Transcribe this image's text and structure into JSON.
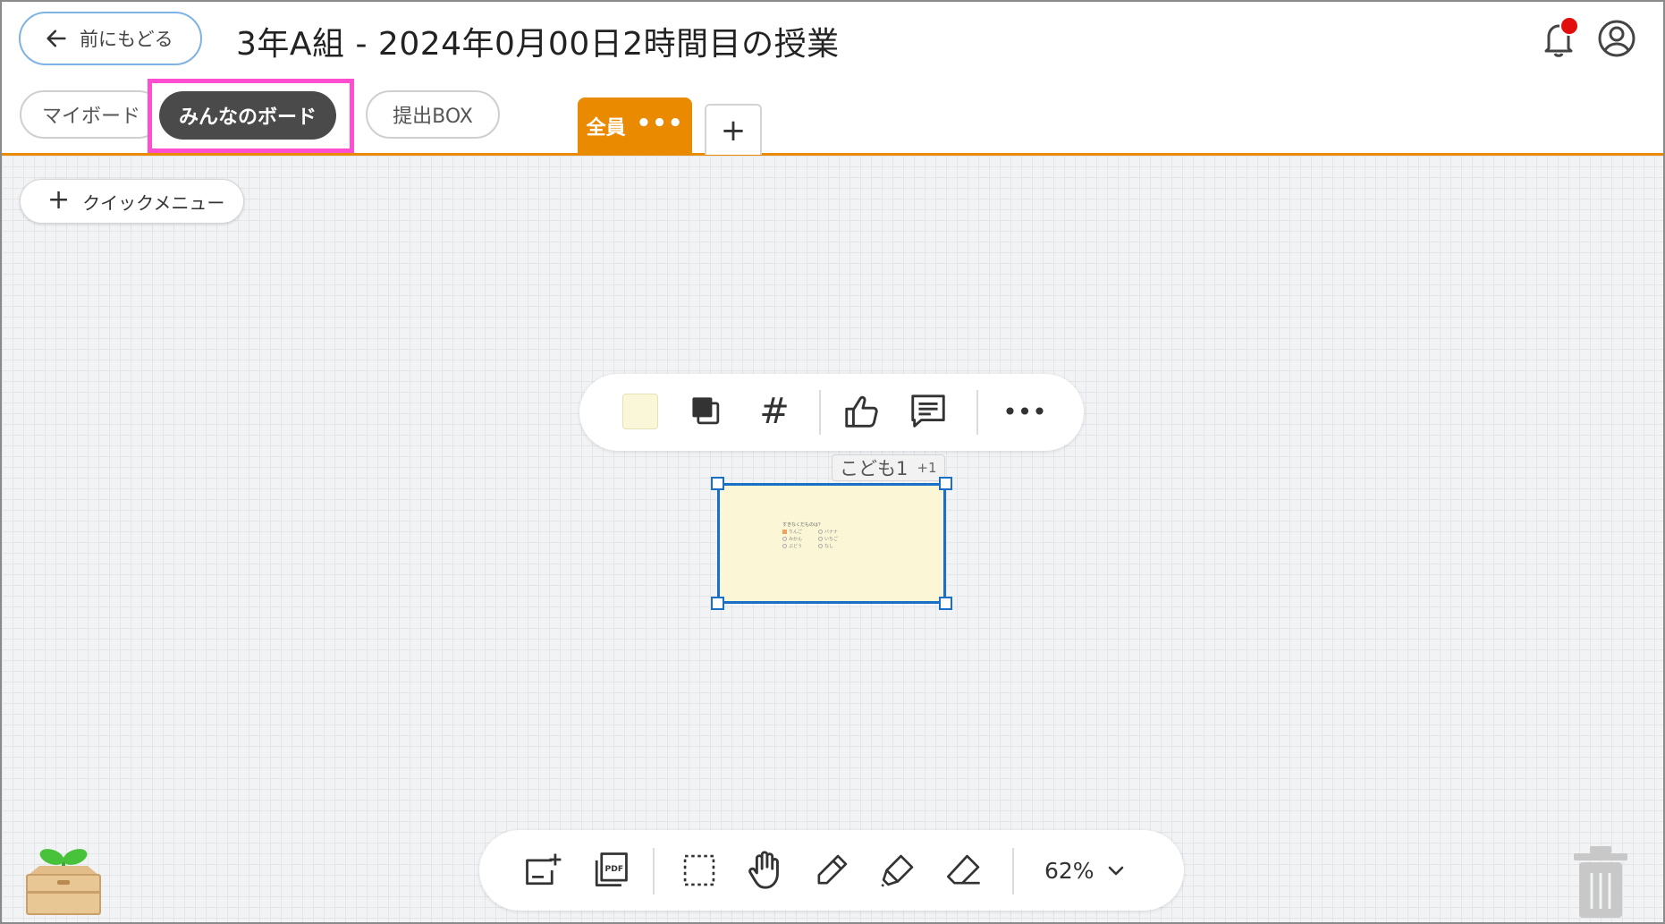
{
  "header": {
    "back_label": "前にもどる",
    "title": "3年A組 - 2024年0月00日2時間目の授業",
    "notification_color": "#e20e0e"
  },
  "tabs": {
    "my_board": "マイボード",
    "everyone_board": "みんなのボード",
    "submit_box": "提出BOX",
    "highlight_color": "#ff4fd0"
  },
  "group_tabs": {
    "active_label": "全員",
    "active_more": "•••",
    "add_label": "+",
    "accent_color": "#ea8a00"
  },
  "canvas": {
    "quick_menu_plus": "+",
    "quick_menu_label": "クイックメニュー"
  },
  "card_toolbar": {
    "icons": [
      "color-swatch-icon",
      "layer-order-icon",
      "hashtag-icon",
      "thumbs-up-icon",
      "comment-icon",
      "more-icon"
    ],
    "hashtag": "#",
    "more": "•••"
  },
  "card": {
    "owner": "こども1",
    "owner_extra": "+1",
    "preview_question": "すきなくだものは？",
    "preview_options_left": [
      "りんご",
      "みかん",
      "ぶどう"
    ],
    "preview_options_right": [
      "バナナ",
      "いちご",
      "なし"
    ],
    "fill_color": "#faf6d6",
    "selection_color": "#1a6fc6"
  },
  "bottom_toolbar": {
    "icons": [
      "add-card-icon",
      "pdf-icon",
      "select-icon",
      "hand-icon",
      "pen-icon",
      "marker-icon",
      "eraser-icon"
    ],
    "zoom": "62%"
  }
}
